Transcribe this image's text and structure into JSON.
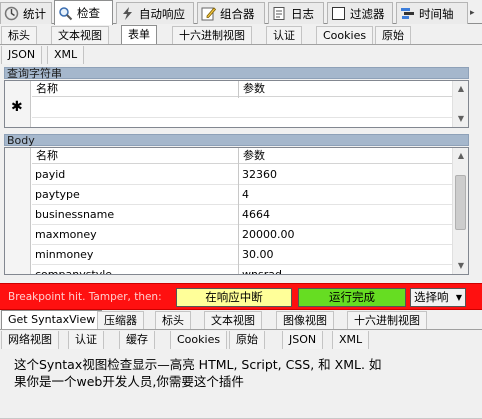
{
  "tool_tabs": [
    {
      "label": "统计",
      "icon": "stats-icon"
    },
    {
      "label": "检查",
      "icon": "inspect-icon",
      "active": true
    },
    {
      "label": "自动响应",
      "icon": "lightning-icon"
    },
    {
      "label": "组合器",
      "icon": "composer-icon"
    },
    {
      "label": "日志",
      "icon": "log-icon"
    },
    {
      "label": "过滤器",
      "icon": "checkbox-icon"
    },
    {
      "label": "时间轴",
      "icon": "timeline-icon"
    }
  ],
  "request_tabs": {
    "row1": [
      "标头",
      "文本视图",
      "表单",
      "十六进制视图",
      "认证",
      "Cookies",
      "原始"
    ],
    "row2": [
      "JSON",
      "XML"
    ],
    "active": "表单"
  },
  "query_section": {
    "title": "查询字符串",
    "columns": [
      "名称",
      "参数"
    ],
    "new_row_marker": "✱"
  },
  "body_section": {
    "title": "Body",
    "columns": [
      "名称",
      "参数"
    ],
    "rows": [
      {
        "name": "payid",
        "value": "32360"
      },
      {
        "name": "paytype",
        "value": "4"
      },
      {
        "name": "businessname",
        "value": "4664"
      },
      {
        "name": "maxmoney",
        "value": "20000.00"
      },
      {
        "name": "minmoney",
        "value": "30.00"
      },
      {
        "name": "companystyle",
        "value": "wnsrad"
      }
    ]
  },
  "breakpoint": {
    "label": "Breakpoint hit. Tamper, then:",
    "break_on_response": "在响应中断",
    "run_to_completion": "运行完成",
    "choose_response": "选择响",
    "colors": {
      "bar": "#ff1010",
      "break_btn": "#ffff99",
      "run_btn": "#66dd22"
    }
  },
  "response_tabs": {
    "row1": [
      "Get SyntaxView",
      "压缩器",
      "标头",
      "文本视图",
      "图像视图",
      "十六进制视图"
    ],
    "row2": [
      "网络视图",
      "认证",
      "缓存",
      "Cookies",
      "原始",
      "JSON",
      "XML"
    ],
    "active": "Get SyntaxView"
  },
  "syntaxview_message": {
    "line1": "这个Syntax视图检查显示—高亮 HTML, Script, CSS, 和 XML. 如",
    "line2": "果你是一个web开发人员,你需要这个插件"
  }
}
